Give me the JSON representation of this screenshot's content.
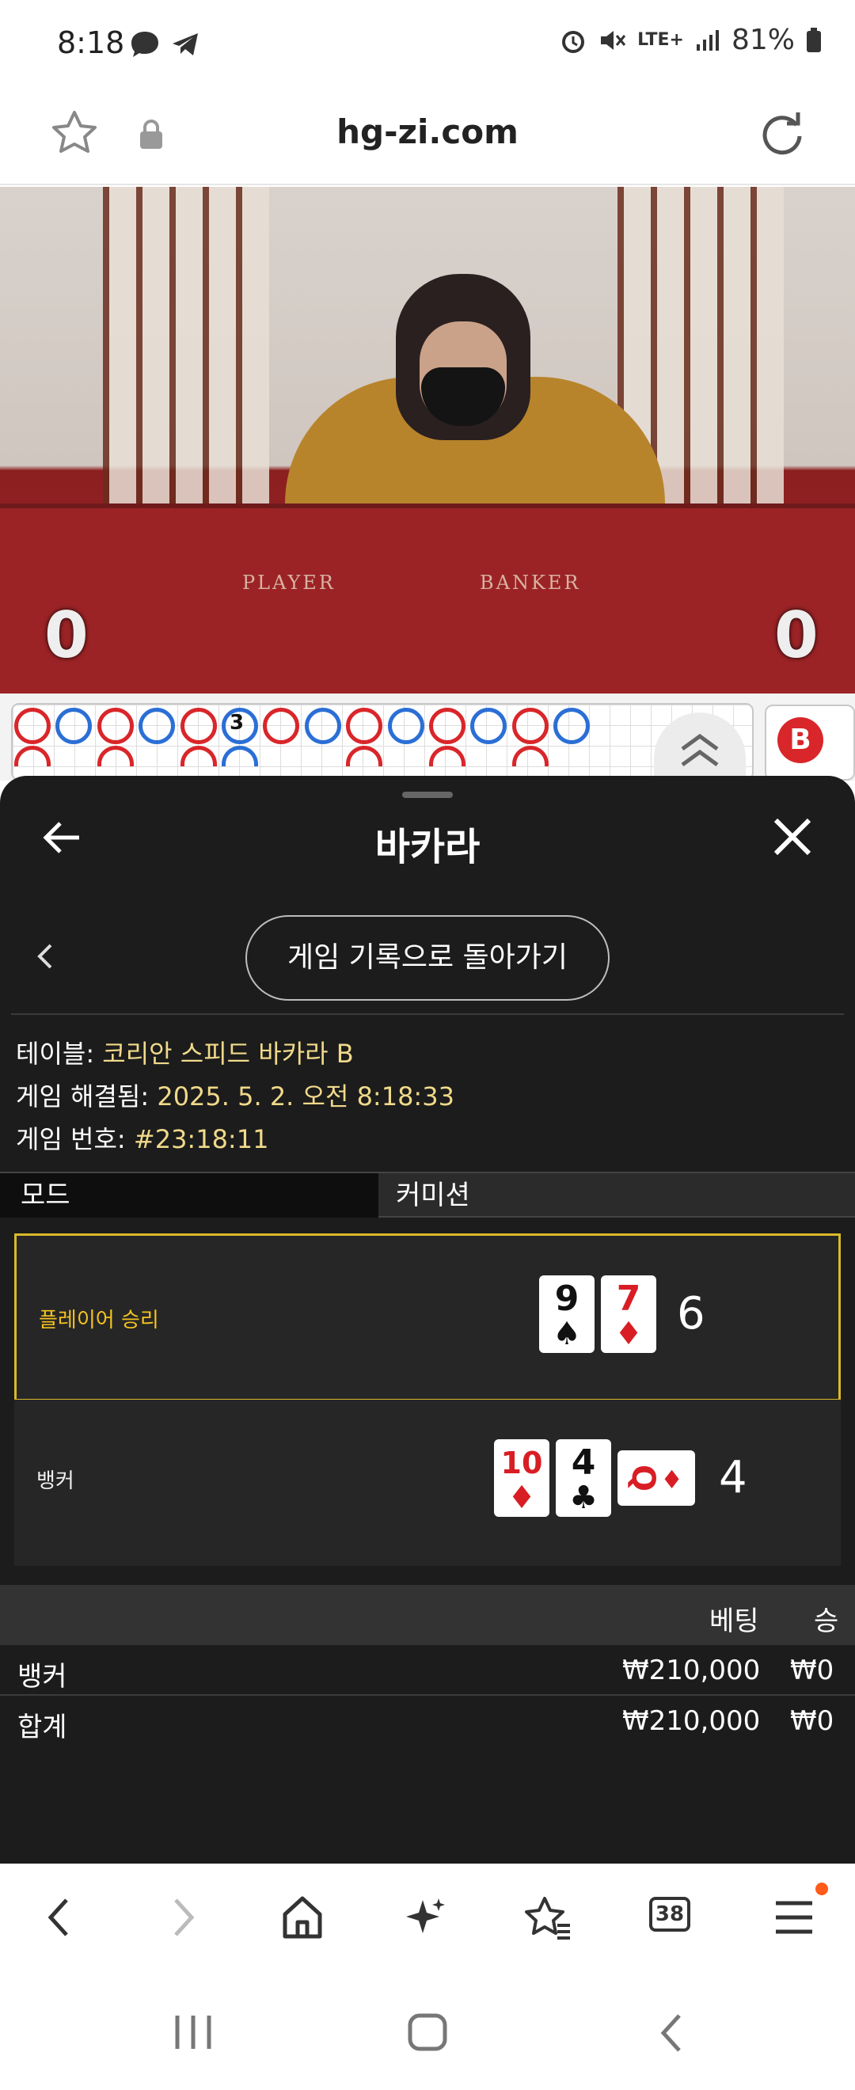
{
  "status_bar": {
    "time": "8:18",
    "battery": "81%",
    "network": "LTE+"
  },
  "browser": {
    "url": "hg-zi.com",
    "tab_count": "38"
  },
  "video": {
    "player_label": "PLAYER",
    "banker_label": "BANKER",
    "left_score": "0",
    "right_score": "0"
  },
  "roadmap": {
    "badge": "B",
    "top_row": [
      "r",
      "b",
      "r",
      "b",
      "r",
      "b",
      "r",
      "b",
      "r",
      "b",
      "r",
      "b",
      "r",
      "b"
    ],
    "bottom_row": [
      "r",
      "",
      "r",
      "",
      "r",
      "b",
      "",
      "",
      "r",
      "",
      "r",
      "",
      "r",
      ""
    ],
    "tie_marker": "3"
  },
  "sheet": {
    "title": "바카라",
    "back_to_history": "게임 기록으로 돌아가기",
    "table_label": "테이블:",
    "table_value": "코리안 스피드 바카라 B",
    "resolved_label": "게임 해결됨:",
    "resolved_value": "2025. 5. 2. 오전 8:18:33",
    "game_no_label": "게임 번호:",
    "game_no_value": "#23:18:11",
    "mode_label": "모드",
    "mode_value": "커미션",
    "player": {
      "label": "플레이어 승리",
      "total": "6",
      "cards": [
        {
          "rank": "9",
          "suit": "♠",
          "color": "black"
        },
        {
          "rank": "7",
          "suit": "♦",
          "color": "red"
        }
      ]
    },
    "banker": {
      "label": "뱅커",
      "total": "4",
      "cards": [
        {
          "rank": "10",
          "suit": "♦",
          "color": "red"
        },
        {
          "rank": "4",
          "suit": "♣",
          "color": "black"
        },
        {
          "rank": "Q",
          "suit": "♦",
          "color": "red"
        }
      ]
    },
    "bets": {
      "col_bet": "베팅",
      "col_win": "승",
      "rows": [
        {
          "name": "뱅커",
          "amount": "₩210,000",
          "win": "₩0"
        },
        {
          "name": "합계",
          "amount": "₩210,000",
          "win": "₩0"
        }
      ]
    }
  }
}
